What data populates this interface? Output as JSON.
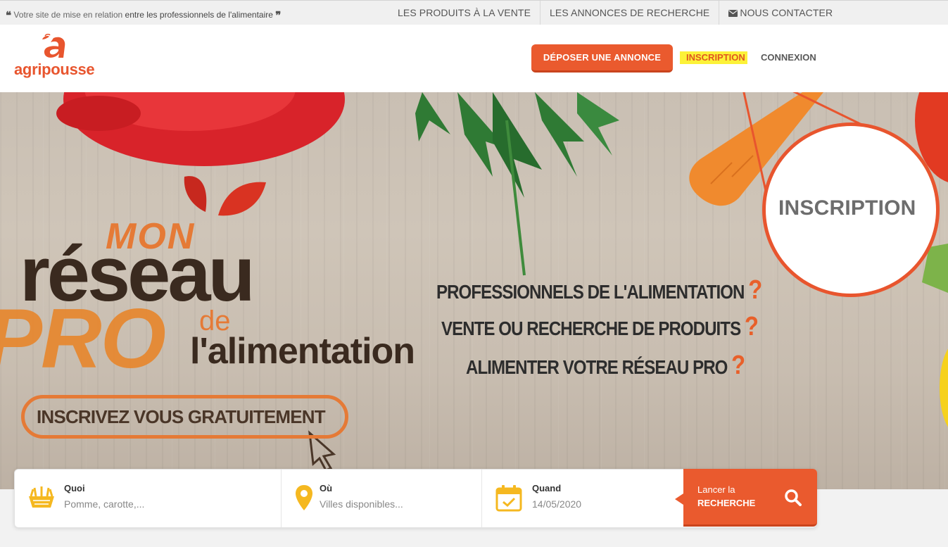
{
  "topbar": {
    "tagline_prefix": "Votre site de mise en relation",
    "tagline_bold": "entre les professionnels de l'alimentaire",
    "open_quote": "❝",
    "close_quote": "❞",
    "links": [
      {
        "label": "LES PRODUITS À LA VENTE"
      },
      {
        "label": "LES ANNONCES DE RECHERCHE"
      },
      {
        "label": "NOUS CONTACTER",
        "icon": "envelope-icon"
      }
    ]
  },
  "header": {
    "logo_text": "agripousse",
    "deposer_label": "DÉPOSER UNE ANNONCE",
    "inscription_label": "INSCRIPTION",
    "connexion_label": "CONNEXION"
  },
  "hero": {
    "mon": "MON",
    "reseau": "réseau",
    "pro": "PRO",
    "de": "de",
    "alimentation": "l'alimentation",
    "cta": "INSCRIVEZ VOUS GRATUITEMENT",
    "pitch": [
      {
        "text": "PROFESSIONNELS DE L'ALIMENTATION",
        "mark": "?"
      },
      {
        "text": "VENTE OU RECHERCHE DE PRODUITS",
        "mark": "?"
      },
      {
        "text": "ALIMENTER VOTRE RÉSEAU PRO",
        "mark": "?"
      }
    ],
    "zoom_label": "INSCRIPTION"
  },
  "search": {
    "quoi": {
      "label": "Quoi",
      "placeholder": "Pomme, carotte,...",
      "icon": "basket-icon"
    },
    "ou": {
      "label": "Où",
      "placeholder": "Villes disponibles...",
      "icon": "location-pin-icon"
    },
    "quand": {
      "label": "Quand",
      "value": "14/05/2020",
      "icon": "calendar-icon"
    },
    "button_small": "Lancer la",
    "button_big": "RECHERCHE",
    "button_icon": "search-icon"
  },
  "colors": {
    "accent": "#ea5a2e",
    "highlight": "#fcf238",
    "icon_yellow": "#f5b820"
  }
}
